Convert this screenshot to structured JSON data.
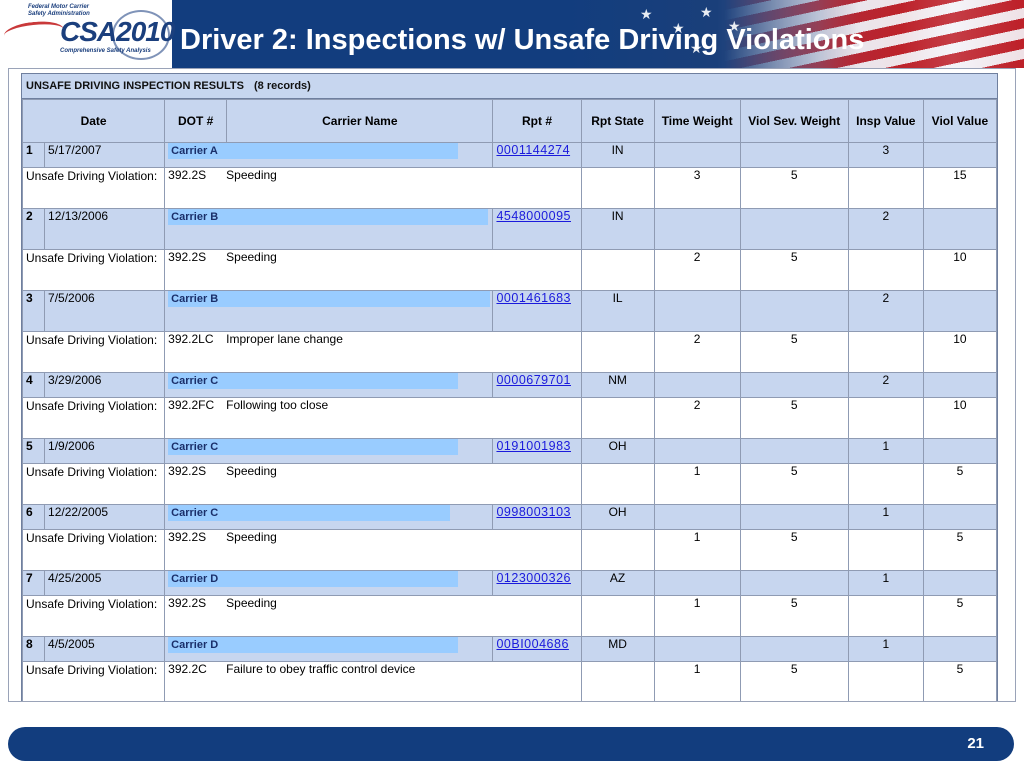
{
  "header": {
    "title": "Driver 2: Inspections w/ Unsafe Driving Violations",
    "logo_agency_line1": "Federal Motor Carrier",
    "logo_agency_line2": "Safety Administration",
    "logo_main": "CSA2010",
    "logo_tagline": "Comprehensive Safety Analysis"
  },
  "results": {
    "title": "UNSAFE DRIVING INSPECTION RESULTS",
    "count": "(8 records)",
    "columns": [
      "Date",
      "DOT #",
      "Carrier Name",
      "Rpt #",
      "Rpt State",
      "Time Weight",
      "Viol Sev. Weight",
      "Insp Value",
      "Viol Value"
    ],
    "violation_label": "Unsafe Driving Violation:",
    "records": [
      {
        "num": "1",
        "date": "5/17/2007",
        "carrier": "Carrier A",
        "rpt": "0001144274",
        "state": "IN",
        "insp_value": "3",
        "code": "392.2S",
        "description": "Speeding",
        "time_weight": "3",
        "sev_weight": "5",
        "viol_value": "15"
      },
      {
        "num": "2",
        "date": "12/13/2006",
        "carrier": "Carrier B",
        "rpt": "4548000095",
        "state": "IN",
        "insp_value": "2",
        "code": "392.2S",
        "description": "Speeding",
        "time_weight": "2",
        "sev_weight": "5",
        "viol_value": "10"
      },
      {
        "num": "3",
        "date": "7/5/2006",
        "carrier": "Carrier B",
        "rpt": "0001461683",
        "state": "IL",
        "insp_value": "2",
        "code": "392.2LC",
        "description": "Improper lane change",
        "time_weight": "2",
        "sev_weight": "5",
        "viol_value": "10"
      },
      {
        "num": "4",
        "date": "3/29/2006",
        "carrier": "Carrier C",
        "rpt": "0000679701",
        "state": "NM",
        "insp_value": "2",
        "code": "392.2FC",
        "description": "Following too close",
        "time_weight": "2",
        "sev_weight": "5",
        "viol_value": "10"
      },
      {
        "num": "5",
        "date": "1/9/2006",
        "carrier": "Carrier C",
        "rpt": "0191001983",
        "state": "OH",
        "insp_value": "1",
        "code": "392.2S",
        "description": "Speeding",
        "time_weight": "1",
        "sev_weight": "5",
        "viol_value": "5"
      },
      {
        "num": "6",
        "date": "12/22/2005",
        "carrier": "Carrier C",
        "rpt": "0998003103",
        "state": "OH",
        "insp_value": "1",
        "code": "392.2S",
        "description": "Speeding",
        "time_weight": "1",
        "sev_weight": "5",
        "viol_value": "5"
      },
      {
        "num": "7",
        "date": "4/25/2005",
        "carrier": "Carrier D",
        "rpt": "0123000326",
        "state": "AZ",
        "insp_value": "1",
        "code": "392.2S",
        "description": "Speeding",
        "time_weight": "1",
        "sev_weight": "5",
        "viol_value": "5"
      },
      {
        "num": "8",
        "date": "4/5/2005",
        "carrier": "Carrier D",
        "rpt": "00BI004686",
        "state": "MD",
        "insp_value": "1",
        "code": "392.2C",
        "description": "Failure to obey traffic control device",
        "time_weight": "1",
        "sev_weight": "5",
        "viol_value": "5"
      }
    ]
  },
  "footer": {
    "page_number": "21"
  }
}
